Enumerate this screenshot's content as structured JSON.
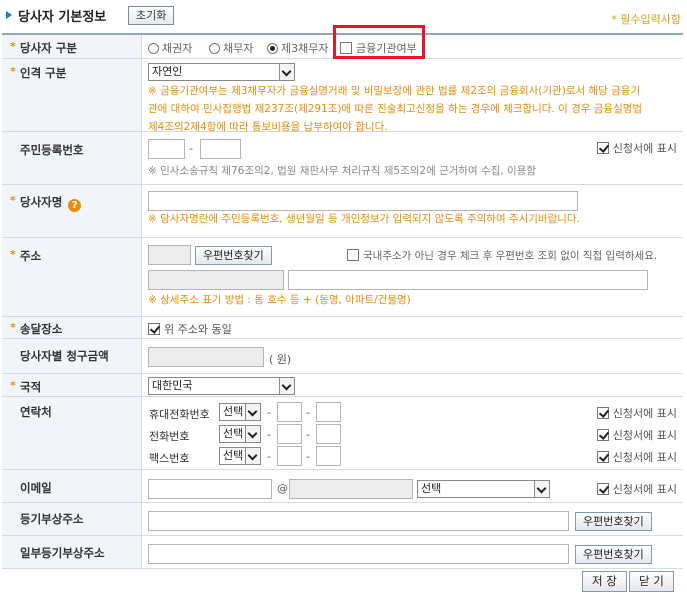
{
  "header": {
    "title": "당사자 기본정보",
    "reset_label": "초기화",
    "required_note": "* 필수입력사항"
  },
  "party_type": {
    "label": "당사자 구분",
    "options": [
      "채권자",
      "채무자",
      "제3채무자"
    ],
    "selected": "제3채무자",
    "financial_checkbox_label": "금융기관여부"
  },
  "person_type": {
    "label": "인격 구분",
    "select_value": "자연인",
    "note_line1": "※ 금융기관여부는 제3채무자가 금융실명거래 및 비밀보장에 관한 법률 제2조의 금융회사(기관)로서 해당 금융기",
    "note_line2": "관에 대하여 민사집행법 제237조(제291조)에 따른 진술최고신청을 하는 경우에 체크합니다. 이 경우 금융실명법",
    "note_line3": "제4조의2제4항에 따라 통보비용을 납부하여야 합니다."
  },
  "resident_number": {
    "label": "주민등록번호",
    "dash": "-",
    "show_label": "신청서에 표시",
    "note": "※ 민사소송규칙 제76조의2, 법원 재판사무 처리규칙 제5조의2에 근거하여 수집, 이용함"
  },
  "party_name": {
    "label": "당사자명",
    "help_icon": "?",
    "note": "※ 당사자명란에 주민등록번호, 생년월일 등 개인정보가 입력되지 않도록 주의하여 주시기바랍니다."
  },
  "address": {
    "label": "주소",
    "zip_button": "우편번호찾기",
    "foreign_checkbox_label": "국내주소가 아닌 경우 체크 후 우편번호 조회 없이 직접 입력하세요.",
    "note": "※ 상세주소 표기 방법 : 동 호수 등 + (동명, 아파트/건물명)"
  },
  "delivery": {
    "label": "송달장소",
    "checkbox_label": "위 주소와 동일"
  },
  "claim_amount": {
    "label": "당사자별 청구금액",
    "unit": "( 원)"
  },
  "nationality": {
    "label": "국적",
    "select_value": "대한민국"
  },
  "contact": {
    "label": "연락처",
    "rows": [
      {
        "label": "휴대전화번호",
        "select": "선택",
        "show": "신청서에 표시"
      },
      {
        "label": "전화번호",
        "select": "선택",
        "show": "신청서에 표시"
      },
      {
        "label": "팩스번호",
        "select": "선택",
        "show": "신청서에 표시"
      }
    ],
    "dash": "-"
  },
  "email": {
    "label": "이메일",
    "at": "@",
    "select_value": "선택",
    "show_label": "신청서에 표시"
  },
  "registry_address": {
    "label": "등기부상주소",
    "zip_button": "우편번호찾기"
  },
  "partial_registry_address": {
    "label": "일부등기부상주소",
    "zip_button": "우편번호찾기"
  },
  "footer": {
    "save_label": "저 장",
    "close_label": "닫 기"
  },
  "colors": {
    "accent": "#1a7fc9",
    "note": "#e98d0e",
    "highlight": "#e3182b",
    "label_bg": "#f1f4f8"
  }
}
